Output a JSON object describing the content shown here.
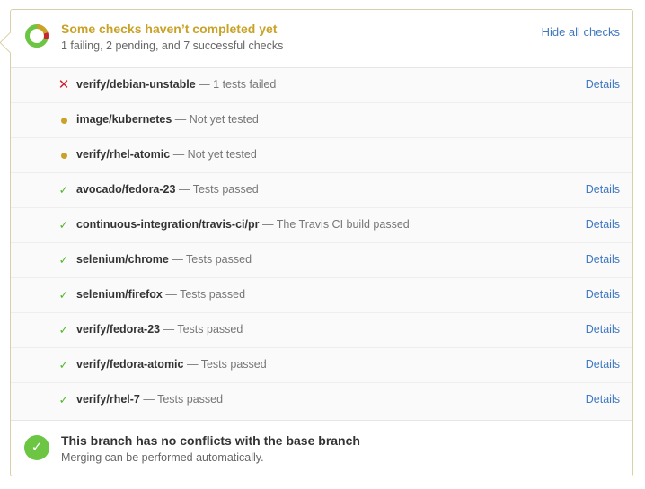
{
  "header": {
    "title": "Some checks haven’t completed yet",
    "subtitle": "1 failing, 2 pending, and 7 successful checks",
    "hide_link": "Hide all checks"
  },
  "checks": [
    {
      "context": "verify/debian-unstable",
      "description": "— 1 tests failed",
      "status": "failure",
      "details": "Details"
    },
    {
      "context": "image/kubernetes",
      "description": "— Not yet tested",
      "status": "pending",
      "details": ""
    },
    {
      "context": "verify/rhel-atomic",
      "description": "— Not yet tested",
      "status": "pending",
      "details": ""
    },
    {
      "context": "avocado/fedora-23",
      "description": "— Tests passed",
      "status": "success",
      "details": "Details"
    },
    {
      "context": "continuous-integration/travis-ci/pr",
      "description": "— The Travis CI build passed",
      "status": "success",
      "details": "Details"
    },
    {
      "context": "selenium/chrome",
      "description": "— Tests passed",
      "status": "success",
      "details": "Details"
    },
    {
      "context": "selenium/firefox",
      "description": "— Tests passed",
      "status": "success",
      "details": "Details"
    },
    {
      "context": "verify/fedora-23",
      "description": "— Tests passed",
      "status": "success",
      "details": "Details"
    },
    {
      "context": "verify/fedora-atomic",
      "description": "— Tests passed",
      "status": "success",
      "details": "Details"
    },
    {
      "context": "verify/rhel-7",
      "description": "— Tests passed",
      "status": "success",
      "details": "Details"
    }
  ],
  "merge": {
    "title": "This branch has no conflicts with the base branch",
    "subtitle": "Merging can be performed automatically."
  },
  "icons": {
    "failure": "x-icon",
    "pending": "dot-icon",
    "success": "check-icon",
    "merge": "check-circle-icon",
    "summary": "status-donut-icon"
  },
  "colors": {
    "pending": "#c9a227",
    "success": "#55b82f",
    "failure": "#cb2431",
    "link": "#4078c0",
    "highlight": "#fff75a"
  }
}
